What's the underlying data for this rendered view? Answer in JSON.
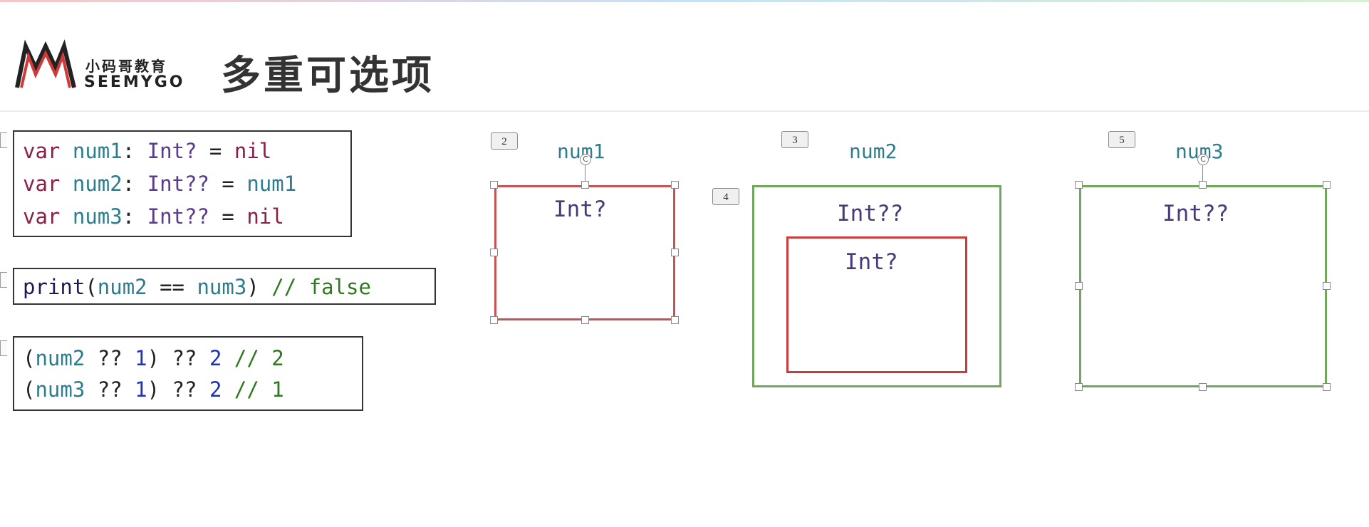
{
  "header": {
    "logo_cn": "小码哥教育",
    "logo_en": "SEEMYGO",
    "title": "多重可选项"
  },
  "code": {
    "decl": [
      {
        "kw": "var",
        "name": "num1",
        "sep": ": ",
        "type": "Int?",
        "eq": " = ",
        "val": "nil"
      },
      {
        "kw": "var",
        "name": "num2",
        "sep": ": ",
        "type": "Int??",
        "eq": " = ",
        "val": "num1"
      },
      {
        "kw": "var",
        "name": "num3",
        "sep": ": ",
        "type": "Int??",
        "eq": " = ",
        "val": "nil"
      }
    ],
    "print": {
      "fn": "print",
      "open": "(",
      "a": "num2",
      "op": " == ",
      "b": "num3",
      "close": ")",
      "comment": " // false"
    },
    "coalesce": [
      {
        "open": "(",
        "name": "num2",
        "op1": " ?? ",
        "n1": "1",
        "close": ")",
        "op2": " ?? ",
        "n2": "2",
        "comment": " // 2"
      },
      {
        "open": "(",
        "name": "num3",
        "op1": " ?? ",
        "n1": "1",
        "close": ")",
        "op2": " ?? ",
        "n2": "2",
        "comment": " // 1"
      }
    ]
  },
  "diagram": {
    "badges": [
      "2",
      "3",
      "4",
      "5"
    ],
    "vars": [
      "num1",
      "num2",
      "num3"
    ],
    "types": {
      "num1_box": "Int?",
      "num2_outer": "Int??",
      "num2_inner": "Int?",
      "num3_box": "Int??"
    },
    "rotate_glyph": "C"
  },
  "colors": {
    "keyword": "#8a1f4a",
    "identifier": "#2d7d8c",
    "type": "#5b3b8c",
    "number": "#2033b8",
    "comment": "#2e7a1e",
    "red_box": "#c95353",
    "green_box": "#6fa85a"
  }
}
